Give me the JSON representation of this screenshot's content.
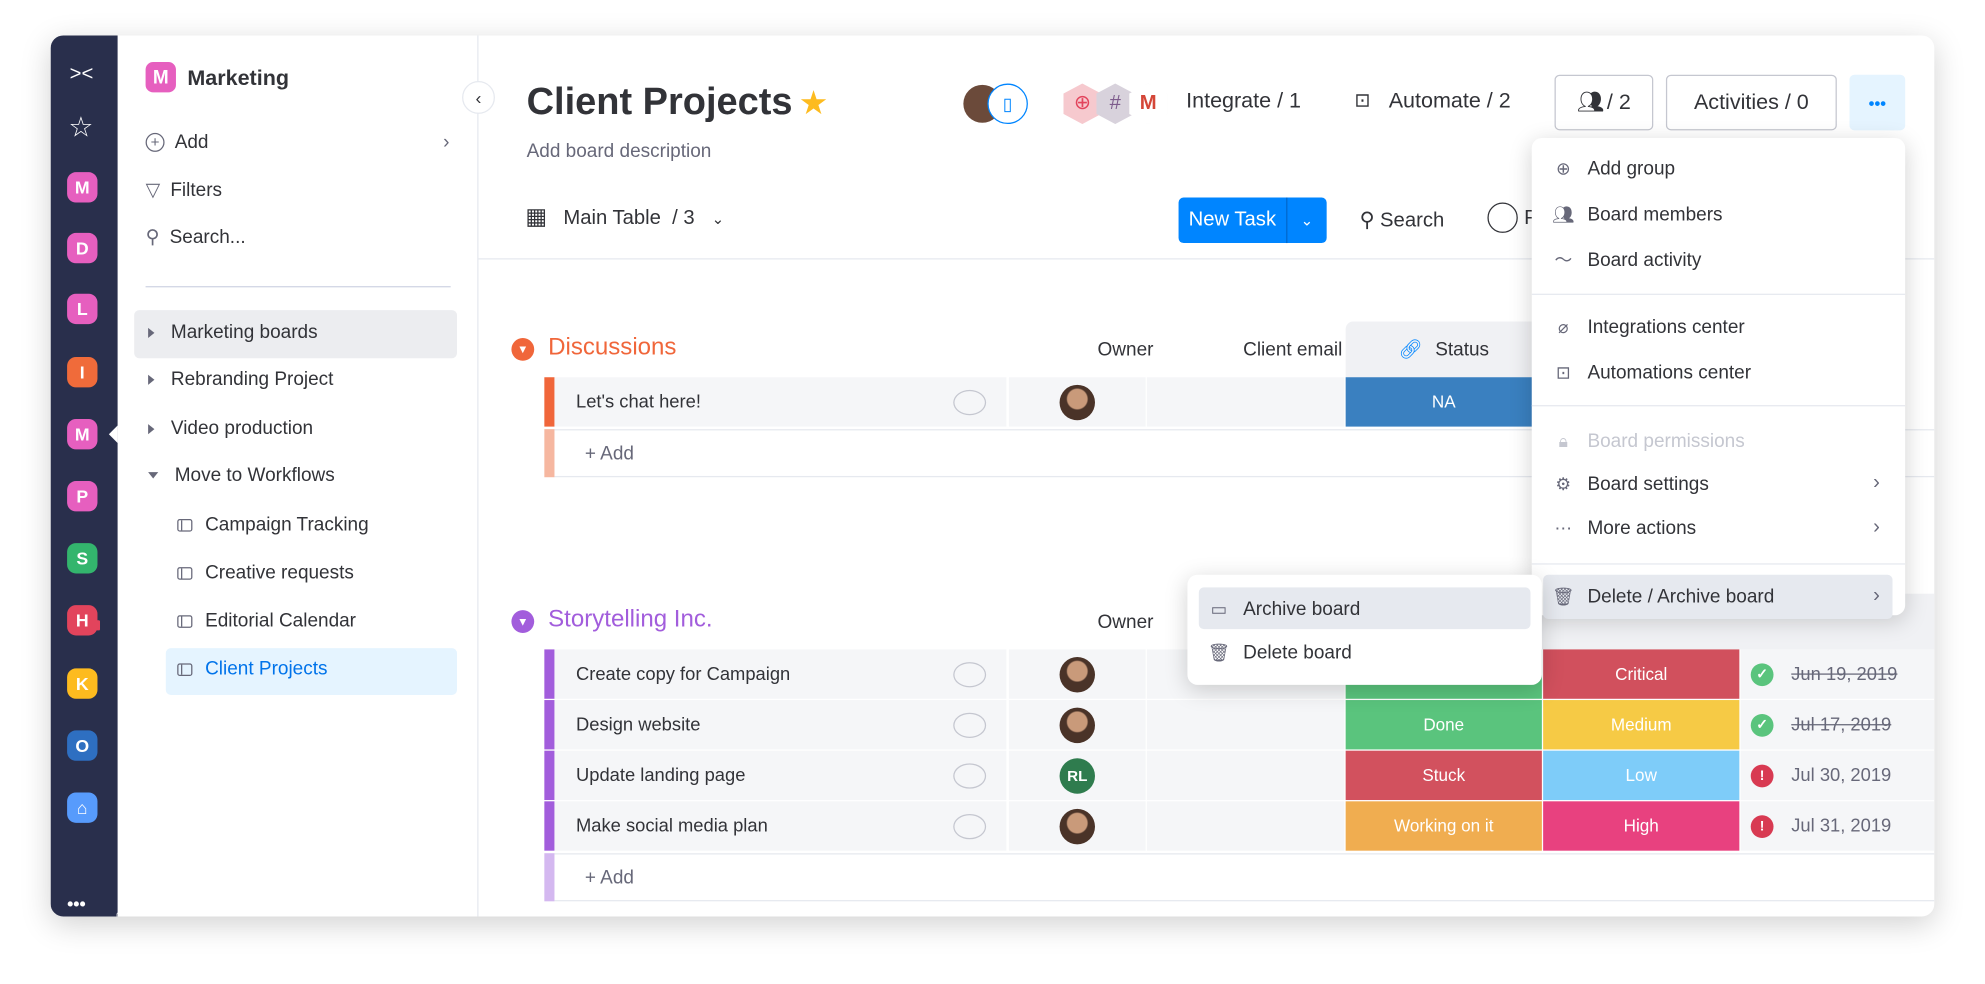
{
  "rail": {
    "workspaces": [
      {
        "letter": "M",
        "color": "#e65fbf",
        "home": true
      },
      {
        "letter": "D",
        "color": "#e65fbf"
      },
      {
        "letter": "L",
        "color": "#e65fbf"
      },
      {
        "letter": "I",
        "color": "#f06b3a"
      },
      {
        "letter": "M",
        "color": "#e65fbf",
        "active": true
      },
      {
        "letter": "P",
        "color": "#e65fbf"
      },
      {
        "letter": "S",
        "color": "#33b56d"
      },
      {
        "letter": "H",
        "color": "#e2445c",
        "locked": true
      },
      {
        "letter": "K",
        "color": "#fdbb1f"
      },
      {
        "letter": "O",
        "color": "#2e6fc1"
      }
    ],
    "more": "•••"
  },
  "sidebar": {
    "workspace_letter": "M",
    "workspace_name": "Marketing",
    "add": "Add",
    "filters": "Filters",
    "search": "Search...",
    "folders": [
      "Marketing boards",
      "Rebranding Project",
      "Video production",
      "Move to Workflows"
    ],
    "boards": [
      "Campaign Tracking",
      "Creative requests",
      "Editorial Calendar",
      "Client Projects"
    ]
  },
  "header": {
    "title": "Client Projects",
    "description": "Add board description",
    "integrate": "Integrate / 1",
    "automate": "Automate / 2",
    "members": "/ 2",
    "activities": "Activities / 0",
    "more": "•••",
    "view": "Main Table",
    "view_count": "/ 3",
    "new_task": "New Task",
    "search": "Search",
    "person": "P"
  },
  "groups": [
    {
      "name": "Discussions",
      "color": "#f0663a",
      "light": "#f6b7a0",
      "columns": {
        "owner": "Owner",
        "email": "Client email",
        "status": "Status"
      },
      "rows": [
        {
          "name": "Let's chat here!",
          "status": "NA",
          "status_color": "#3a80c0"
        }
      ],
      "add": "+ Add"
    },
    {
      "name": "Storytelling Inc.",
      "color": "#a25ddc",
      "light": "#d4b8f0",
      "columns": {
        "owner": "Owner"
      },
      "rows": [
        {
          "name": "Create copy for Campaign",
          "owner": "photo",
          "status": "",
          "status_color": "#5ac47d",
          "priority": "Critical",
          "priority_color": "#d1505d",
          "date": "Jun 19, 2019",
          "done": true
        },
        {
          "name": "Design website",
          "owner": "photo",
          "status": "Done",
          "status_color": "#5ac47d",
          "priority": "Medium",
          "priority_color": "#f6ca45",
          "date": "Jul 17, 2019",
          "done": true
        },
        {
          "name": "Update landing page",
          "owner": "RL",
          "status": "Stuck",
          "status_color": "#d2515e",
          "priority": "Low",
          "priority_color": "#7eccf9",
          "date": "Jul 30, 2019",
          "done": false
        },
        {
          "name": "Make social media plan",
          "owner": "photo",
          "status": "Working on it",
          "status_color": "#f0ad50",
          "priority": "High",
          "priority_color": "#e8417f",
          "date": "Jul 31, 2019",
          "done": false
        }
      ],
      "add": "+ Add"
    }
  ],
  "menu": {
    "items": [
      "Add group",
      "Board members",
      "Board activity",
      "Integrations center",
      "Automations center",
      "Board permissions",
      "Board settings",
      "More actions",
      "Delete / Archive board"
    ]
  },
  "submenu": {
    "items": [
      "Archive board",
      "Delete board"
    ]
  }
}
